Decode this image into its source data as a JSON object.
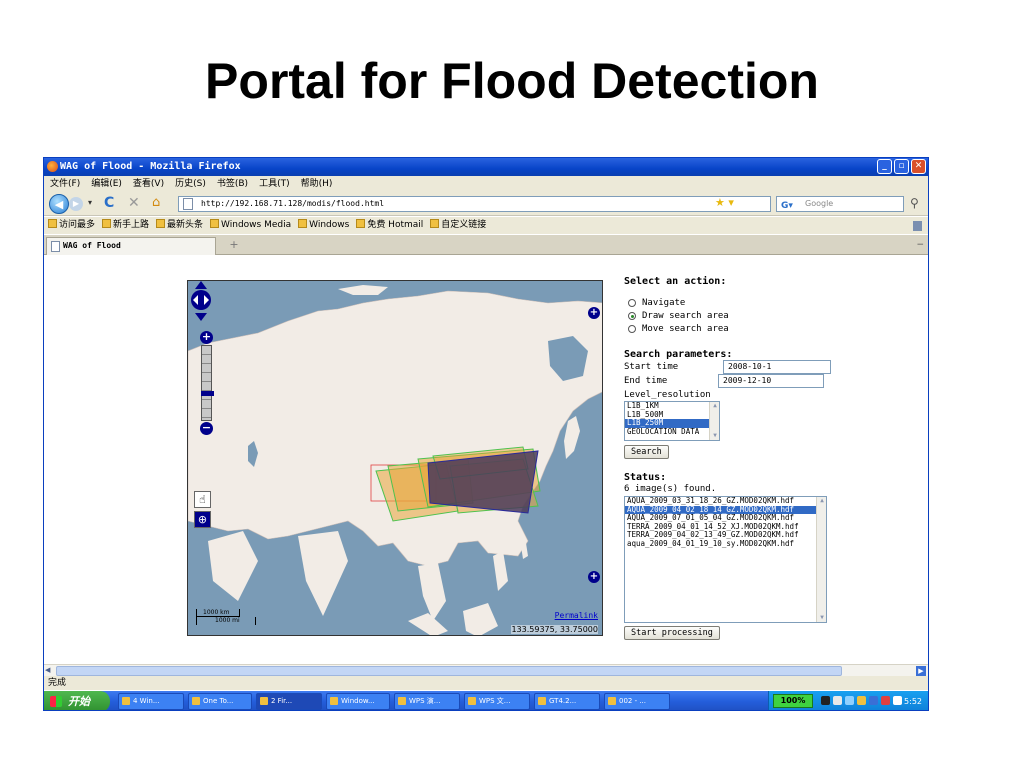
{
  "slide": {
    "title": "Portal for Flood Detection"
  },
  "browser": {
    "window_title": "WAG of Flood - Mozilla Firefox",
    "menu": [
      "文件(F)",
      "编辑(E)",
      "查看(V)",
      "历史(S)",
      "书签(B)",
      "工具(T)",
      "帮助(H)"
    ],
    "url": "http://192.168.71.128/modis/flood.html",
    "search_placeholder": "Google",
    "bookmarks": [
      "访问最多",
      "新手上路",
      "最新头条",
      "Windows Media",
      "Windows",
      "免费 Hotmail",
      "自定义链接"
    ],
    "tab_title": "WAG of Flood",
    "status_text": "完成"
  },
  "map": {
    "permalink": "Permalink",
    "coords": "133.59375, 33.75000",
    "scale_top": "1000 km",
    "scale_bottom": "1000 mi"
  },
  "panel": {
    "action_header": "Select an action:",
    "actions": [
      {
        "label": "Navigate",
        "selected": false
      },
      {
        "label": "Draw search area",
        "selected": true
      },
      {
        "label": "Move search area",
        "selected": false
      }
    ],
    "params_header": "Search parameters:",
    "start_label": "Start time",
    "start_value": "2008-10-1",
    "end_label": "End time",
    "end_value": "2009-12-10",
    "level_label": "Level_resolution",
    "levels": [
      "L1B_1KM",
      "L1B_500M",
      "L1B_250M",
      "GEOLOCATION DATA"
    ],
    "level_selected_index": 2,
    "search_button": "Search",
    "status_header": "Status:",
    "status_text": "6 image(s) found.",
    "results": [
      "AQUA_2009_03_31_18_26_GZ.MOD02QKM.hdf",
      "AQUA_2009_04_02_18_14_GZ.MOD02QKM.hdf",
      "AQUA_2009_07_01_05_04_GZ.MOD02QKM.hdf",
      "TERRA_2009_04_01_14_52_XJ.MOD02QKM.hdf",
      "TERRA_2009_04_02_13_49_GZ.MOD02QKM.hdf",
      "aqua_2009_04_01_19_10_sy.MOD02QKM.hdf"
    ],
    "result_selected_index": 1,
    "process_button": "Start processing"
  },
  "taskbar": {
    "start_label": "开始",
    "tasks": [
      "4 Win...",
      "One To...",
      "2 Fir...",
      "Window...",
      "WPS 演...",
      "WPS 文...",
      "GT4.2...",
      "002 - ..."
    ],
    "battery": "100%",
    "clock": "5:52"
  },
  "colors": {
    "title_bar": "#0844c8",
    "map_water": "#7a9bb6",
    "map_land": "#f2ece6",
    "footprint_fill": "#e8a53a",
    "footprint_selected": "#4a3a5a",
    "selection_blue": "#316ac5"
  }
}
